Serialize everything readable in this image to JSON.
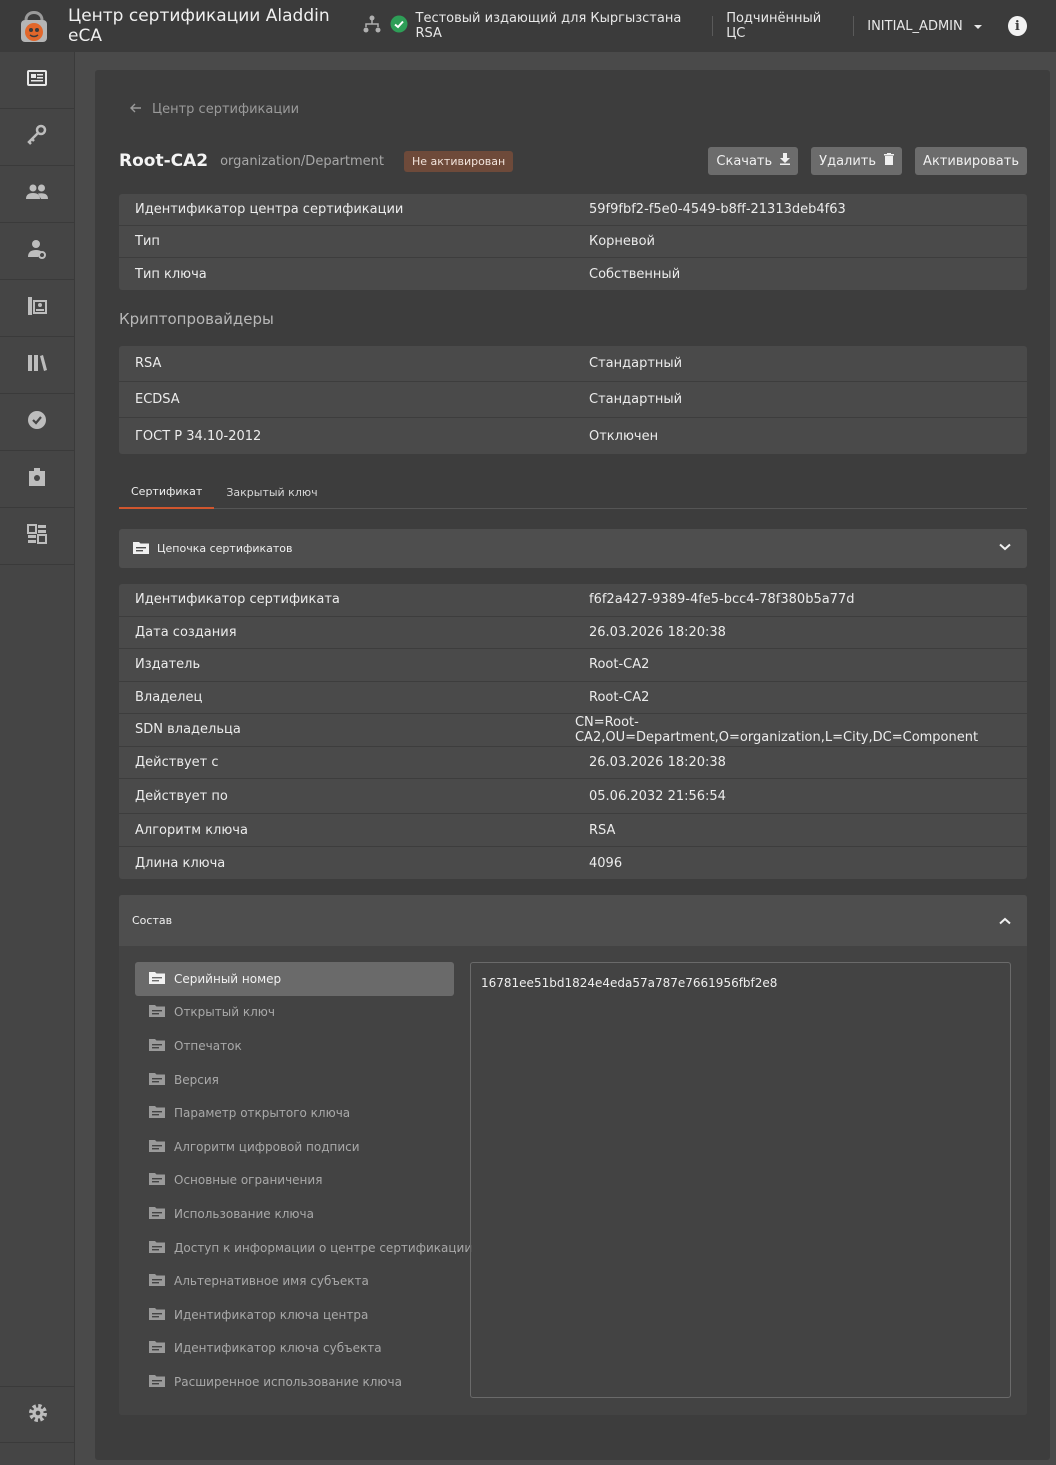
{
  "app": {
    "title": "Центр сертификации Aladdin eCA"
  },
  "topbar": {
    "issuer_label": "Тестовый издающий для Кыргызстана RSA",
    "subordinate_label": "Подчинённый ЦС",
    "user_label": "INITIAL_ADMIN",
    "info_label": "i",
    "accent": "#2e9e57"
  },
  "sidebar": {
    "items": [
      {
        "icon": "certificate-card-icon"
      },
      {
        "icon": "key-icon"
      },
      {
        "icon": "users-icon"
      },
      {
        "icon": "user-key-icon"
      },
      {
        "icon": "user-certificate-icon"
      },
      {
        "icon": "library-icon"
      },
      {
        "icon": "verified-badge-icon"
      },
      {
        "icon": "certificate-badge-icon"
      },
      {
        "icon": "dashboard-icon"
      }
    ],
    "bottom_icon": "settings-gear-icon"
  },
  "breadcrumb": {
    "label": "Центр сертификации"
  },
  "header": {
    "name": "Root-CA2",
    "org": "organization/Department",
    "status": "Не активирован",
    "status_color": "#6e4a3a",
    "buttons": {
      "download": "Скачать",
      "delete": "Удалить",
      "activate": "Активировать"
    }
  },
  "info": [
    {
      "key": "Идентификатор центра сертификации",
      "value": "59f9fbf2-f5e0-4549-b8ff-21313deb4f63"
    },
    {
      "key": "Тип",
      "value": "Корневой"
    },
    {
      "key": "Тип ключа",
      "value": "Собственный"
    }
  ],
  "crypto": {
    "title": "Криптопровайдеры",
    "rows": [
      {
        "key": "RSA",
        "value": "Стандартный"
      },
      {
        "key": "ECDSA",
        "value": "Стандартный"
      },
      {
        "key": "ГОСТ Р 34.10-2012",
        "value": "Отключен"
      }
    ]
  },
  "tabs": [
    {
      "label": "Сертификат",
      "active": true
    },
    {
      "label": "Закрытый ключ",
      "active": false
    }
  ],
  "chain": {
    "label": "Цепочка сертификатов"
  },
  "cert": [
    {
      "key": "Идентификатор сертификата",
      "value": "f6f2a427-9389-4fe5-bcc4-78f380b5a77d"
    },
    {
      "key": "Дата создания",
      "value": "26.03.2026 18:20:38"
    },
    {
      "key": "Издатель",
      "value": "Root-CA2"
    },
    {
      "key": "Владелец",
      "value": "Root-CA2"
    },
    {
      "key": "SDN владельца",
      "value": "CN=Root-CA2,OU=Department,O=organization,L=City,DC=Component"
    },
    {
      "key": "Действует с",
      "value": "26.03.2026 18:20:38"
    },
    {
      "key": "Действует по",
      "value": "05.06.2032 21:56:54"
    },
    {
      "key": "Алгоритм ключа",
      "value": "RSA"
    },
    {
      "key": "Длина ключа",
      "value": "4096"
    }
  ],
  "sostav": {
    "title": "Состав",
    "items": [
      "Серийный номер",
      "Открытый ключ",
      "Отпечаток",
      "Версия",
      "Параметр открытого ключа",
      "Алгоритм цифровой подписи",
      "Основные ограничения",
      "Использование ключа",
      "Доступ к информации о центре сертификации",
      "Альтернативное имя субъекта",
      "Идентификатор ключа центра",
      "Идентификатор ключа субъекта",
      "Расширенное использование ключа"
    ],
    "selected_index": 0,
    "value": "16781ee51bd1824e4eda57a787e7661956fbf2e8"
  }
}
